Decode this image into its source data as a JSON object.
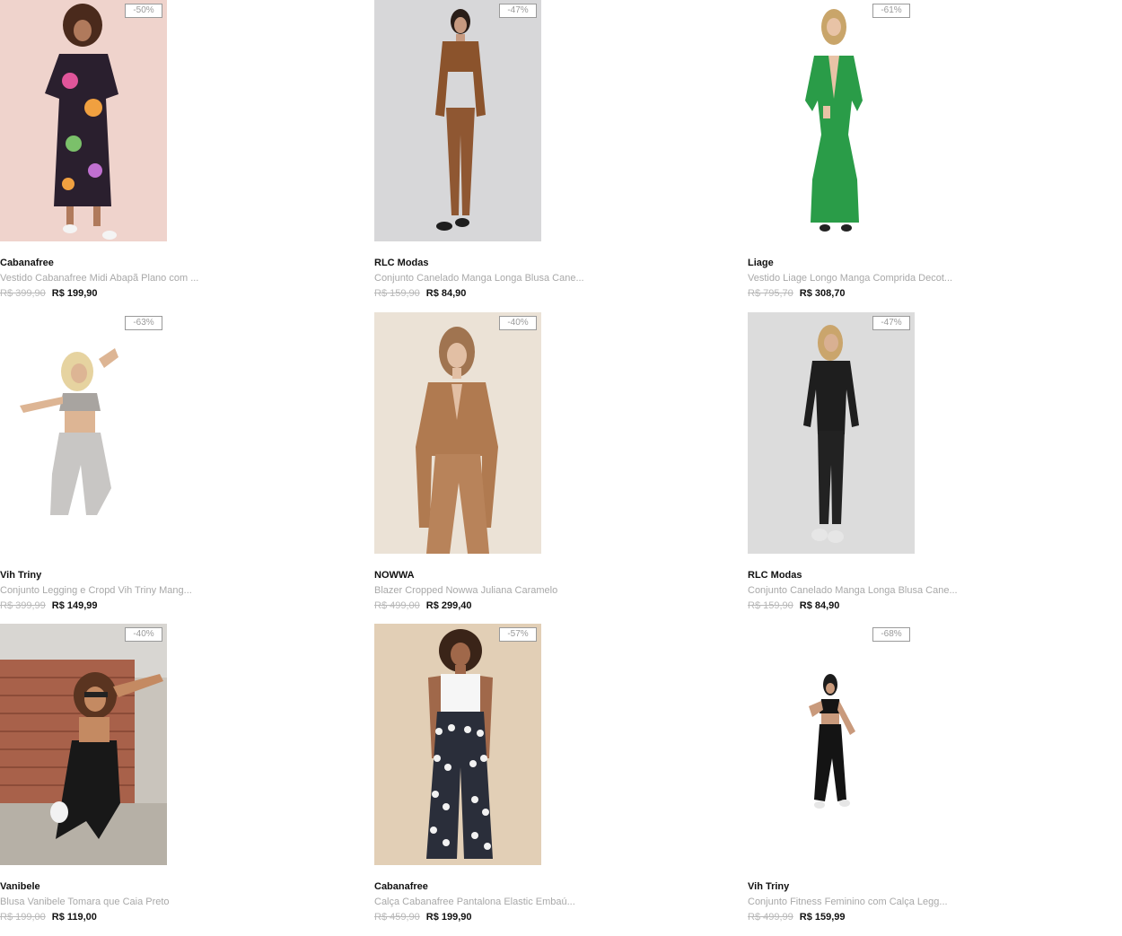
{
  "products": [
    {
      "brand": "Cabanafree",
      "description": "Vestido Cabanafree Midi Abapã Plano com ...",
      "old_price": "R$ 399,90",
      "price": "R$ 199,90",
      "discount": "-50%"
    },
    {
      "brand": "RLC Modas",
      "description": "Conjunto Canelado Manga Longa Blusa Cane...",
      "old_price": "R$ 159,90",
      "price": "R$ 84,90",
      "discount": "-47%"
    },
    {
      "brand": "Liage",
      "description": "Vestido Liage Longo Manga Comprida Decot...",
      "old_price": "R$ 795,70",
      "price": "R$ 308,70",
      "discount": "-61%"
    },
    {
      "brand": "Vih Triny",
      "description": "Conjunto Legging e Cropd Vih Triny Mang...",
      "old_price": "R$ 399,99",
      "price": "R$ 149,99",
      "discount": "-63%"
    },
    {
      "brand": "NOWWA",
      "description": "Blazer Cropped Nowwa Juliana Caramelo",
      "old_price": "R$ 499,00",
      "price": "R$ 299,40",
      "discount": "-40%"
    },
    {
      "brand": "RLC Modas",
      "description": "Conjunto Canelado Manga Longa Blusa Cane...",
      "old_price": "R$ 159,90",
      "price": "R$ 84,90",
      "discount": "-47%"
    },
    {
      "brand": "Vanibele",
      "description": "Blusa Vanibele Tomara que Caia Preto",
      "old_price": "R$ 199,00",
      "price": "R$ 119,00",
      "discount": "-40%"
    },
    {
      "brand": "Cabanafree",
      "description": "Calça Cabanafree Pantalona Elastic Embaú...",
      "old_price": "R$ 459,90",
      "price": "R$ 199,90",
      "discount": "-57%"
    },
    {
      "brand": "Vih Triny",
      "description": "Conjunto Fitness Feminino com Calça Legg...",
      "old_price": "R$ 499,99",
      "price": "R$ 159,99",
      "discount": "-68%"
    }
  ]
}
